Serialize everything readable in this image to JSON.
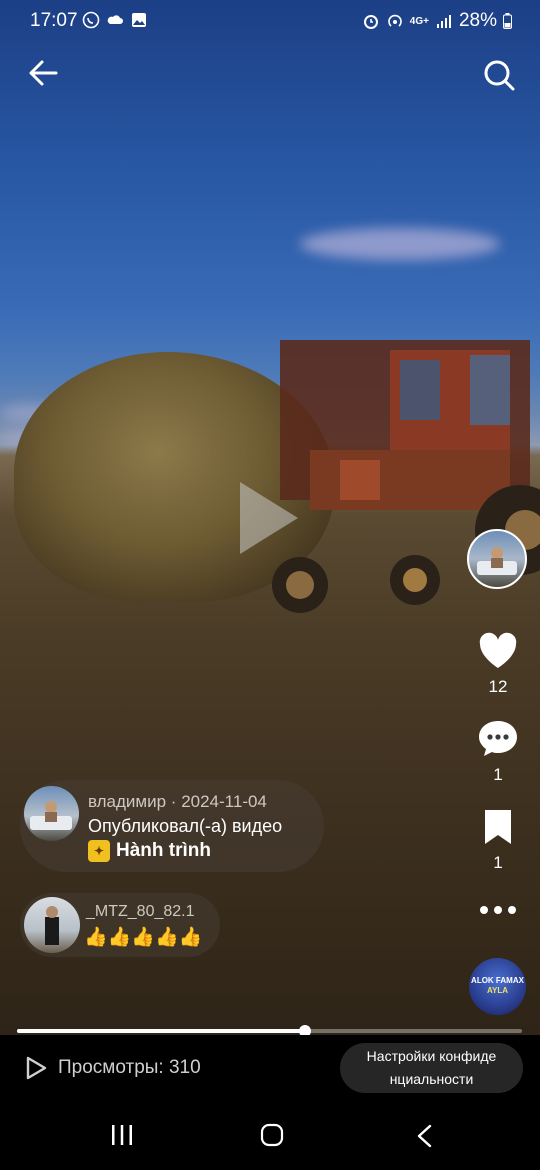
{
  "status_bar": {
    "time": "17:07",
    "network": "4G+",
    "battery": "28%",
    "left_icons": [
      "whatsapp-icon",
      "cloud-icon",
      "gallery-icon"
    ],
    "right_icons": [
      "alarm-icon",
      "hotspot-icon",
      "network-icon",
      "signal-icon",
      "battery-icon"
    ]
  },
  "header": {
    "back_icon": "arrow-left-icon",
    "search_icon": "search-icon"
  },
  "actions": {
    "likes": "12",
    "comments": "1",
    "saves": "1"
  },
  "post": {
    "user": "владимир",
    "date": "2024-11-04",
    "text": "Опубликовал(-а) видео",
    "tag": "Hành trình"
  },
  "comment": {
    "user": "_MTZ_80_82.1",
    "text": "👍👍👍👍👍"
  },
  "music_disc": {
    "label": "ALOK FAMAX",
    "sub": "AYLA"
  },
  "progress": {
    "fraction": 0.57
  },
  "bottom": {
    "views_label": "Просмотры: 310",
    "privacy_line1": "Настройки конфиде",
    "privacy_line2": "нциальности"
  },
  "colors": {
    "sky": "#2a5aa6",
    "field": "#4a3b26",
    "accent_tag": "#f0c020"
  }
}
